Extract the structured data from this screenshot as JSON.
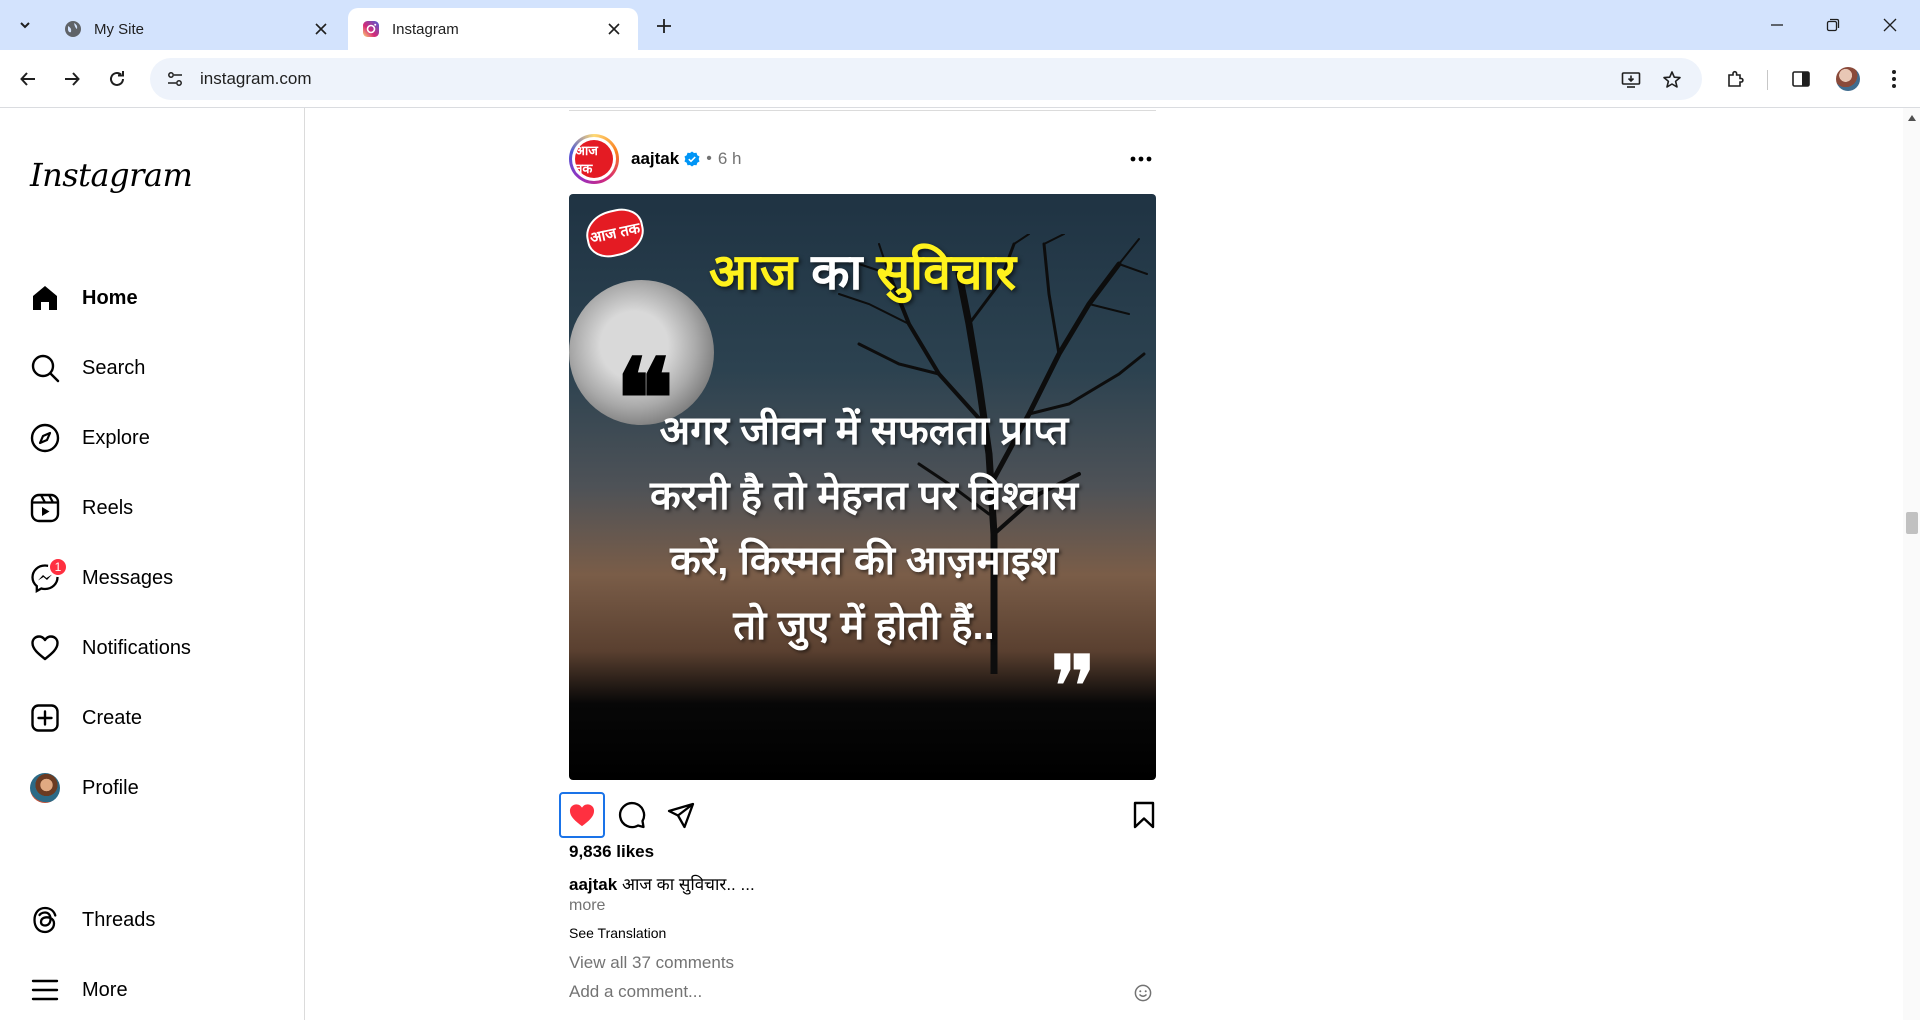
{
  "browser": {
    "tabs": [
      {
        "title": "My Site",
        "icon": "globe-icon",
        "active": false
      },
      {
        "title": "Instagram",
        "icon": "instagram-favicon",
        "active": true
      }
    ],
    "url": "instagram.com"
  },
  "sidebar": {
    "logo": "Instagram",
    "items": [
      {
        "label": "Home",
        "icon": "home-icon",
        "active": true
      },
      {
        "label": "Search",
        "icon": "search-icon"
      },
      {
        "label": "Explore",
        "icon": "compass-icon"
      },
      {
        "label": "Reels",
        "icon": "reels-icon"
      },
      {
        "label": "Messages",
        "icon": "messenger-icon",
        "badge": "1"
      },
      {
        "label": "Notifications",
        "icon": "heart-icon"
      },
      {
        "label": "Create",
        "icon": "plus-square-icon"
      },
      {
        "label": "Profile",
        "icon": "avatar"
      }
    ],
    "bottom": [
      {
        "label": "Threads",
        "icon": "threads-icon"
      },
      {
        "label": "More",
        "icon": "menu-icon"
      }
    ]
  },
  "post": {
    "username": "aajtak",
    "avatar_text": "आज तक",
    "time": "6 h",
    "dot": "•",
    "image": {
      "logo_text": "आज तक",
      "title_part1": "आज",
      "title_part2": "का",
      "title_part3": "सुविचार",
      "quote_line1": "अगर जीवन में सफलता प्राप्त",
      "quote_line2": "करनी है तो मेहनत पर विश्वास",
      "quote_line3": "करें,  किस्मत की आज़माइश",
      "quote_line4": "तो जुए में होती हैं..",
      "quote_open": "❝",
      "quote_close": "❞"
    },
    "likes": "9,836 likes",
    "caption_user": "aajtak",
    "caption_text": "आज का सुविचार.. ...",
    "more": "more",
    "see_translation": "See Translation",
    "view_comments": "View all 37 comments",
    "add_comment_placeholder": "Add a comment...",
    "liked": true,
    "colors": {
      "like": "#ff3040",
      "title_yellow": "#fff21c",
      "verified": "#0095f6"
    }
  }
}
